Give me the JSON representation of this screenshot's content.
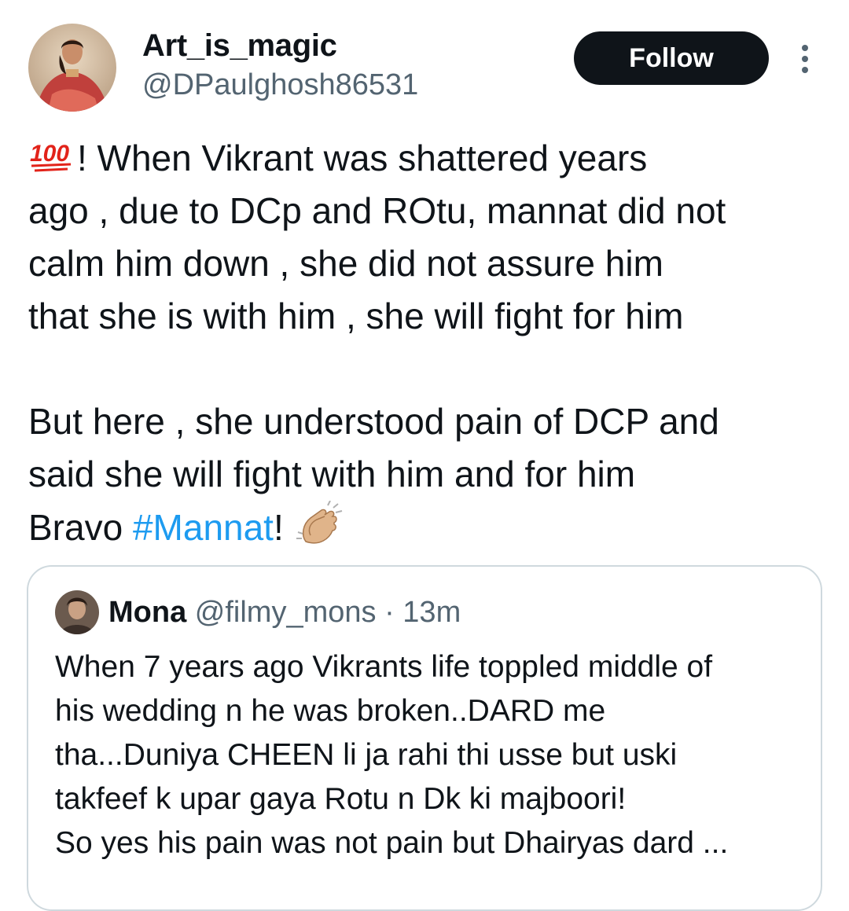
{
  "author": {
    "display_name": "Art_is_magic",
    "handle": "@DPaulghosh86531",
    "follow_label": "Follow"
  },
  "tweet": {
    "lines": [
      "! When Vikrant was shattered years",
      "ago , due to DCp and ROtu, mannat did not",
      "calm him down , she did not assure him",
      "that she is with him , she will fight for him",
      "But here , she understood pain of DCP and",
      "said she will fight with him and for him",
      "Bravo ",
      "!"
    ],
    "hashtag": "#Mannat",
    "emoji_text": "100",
    "icons": [
      "hundred-points-emoji",
      "clapping-hands-emoji"
    ]
  },
  "quote": {
    "name": "Mona",
    "handle": "@filmy_mons",
    "separator": "·",
    "time": "13m",
    "lines": [
      "When 7 years ago Vikrants life toppled middle of",
      "his wedding n he was broken..DARD me",
      "tha...Duniya CHEEN li ja rahi thi usse but uski",
      "takfeef k upar gaya Rotu n Dk ki majboori!",
      "So yes his pain was not pain but Dhairyas dard ..."
    ]
  },
  "colors": {
    "text": "#0f1419",
    "secondary": "#536471",
    "link": "#1d9bf0",
    "border": "#cfd9de",
    "button_bg": "#0f1419",
    "button_text": "#ffffff"
  }
}
